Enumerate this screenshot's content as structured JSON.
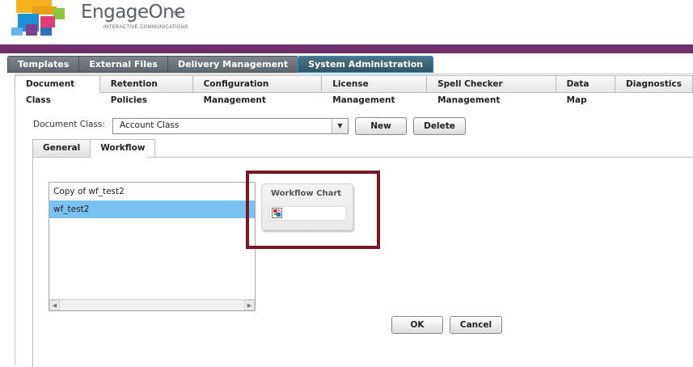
{
  "brand": {
    "name": "EngageOne",
    "trademark": "TM",
    "tagline": "INTERACTIVE COMMUNICATIONS"
  },
  "main_tabs": [
    {
      "label": "Templates"
    },
    {
      "label": "External Files"
    },
    {
      "label": "Delivery Management"
    },
    {
      "label": "System Administration",
      "active": true
    }
  ],
  "sub_tabs": [
    {
      "label": "Document Class",
      "active": true
    },
    {
      "label": "Retention Policies"
    },
    {
      "label": "Configuration Management"
    },
    {
      "label": "License Management"
    },
    {
      "label": "Spell Checker Management"
    },
    {
      "label": "Data Map"
    },
    {
      "label": "Diagnostics"
    }
  ],
  "document_class": {
    "label": "Document Class:",
    "selected": "Account Class",
    "new_label": "New",
    "delete_label": "Delete"
  },
  "inner_tabs": [
    {
      "label": "General"
    },
    {
      "label": "Workflow",
      "active": true
    }
  ],
  "workflows": [
    {
      "label": "Copy of wf_test2",
      "selected": false
    },
    {
      "label": "wf_test2",
      "selected": true
    }
  ],
  "workflow_chart": {
    "title": "Workflow Chart",
    "image_icon": "broken-image-icon"
  },
  "footer": {
    "ok_label": "OK",
    "cancel_label": "Cancel"
  },
  "colors": {
    "brand_band": "#6e2f6a",
    "highlight_box": "#7a1524",
    "selection": "#79c3f2",
    "active_main_tab": "#2f5666"
  }
}
